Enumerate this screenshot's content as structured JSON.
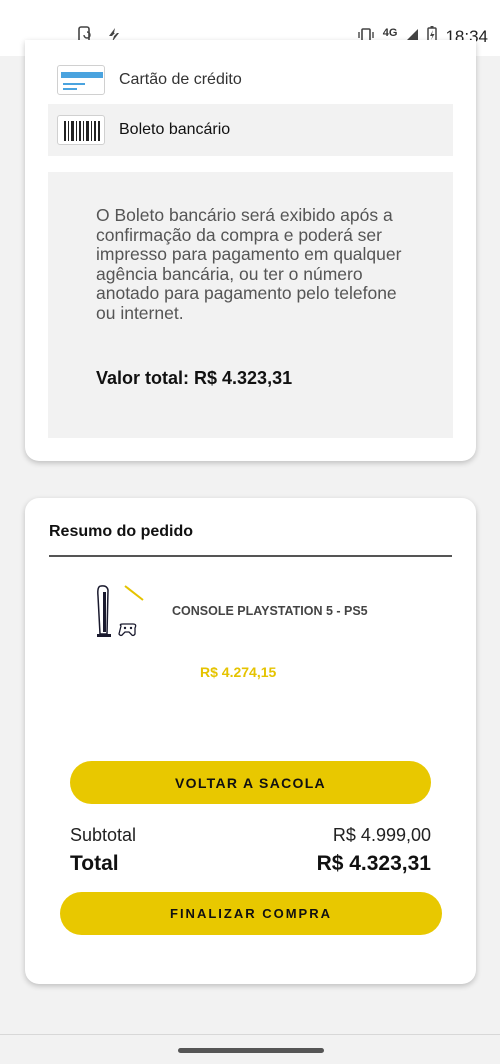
{
  "status_bar": {
    "left_icons": [
      "phone-sync-icon",
      "no-signal-bolt-icon"
    ],
    "right_icons": [
      "vibrate-icon",
      "signal-icon",
      "battery-charging-icon"
    ],
    "network": "4G",
    "time": "18:34"
  },
  "payment": {
    "options": [
      {
        "label": "Cartão de crédito",
        "icon": "credit-card-icon",
        "selected": false
      },
      {
        "label": "Boleto bancário",
        "icon": "barcode-icon",
        "selected": true
      }
    ],
    "boleto_info": "O Boleto bancário será exibido após a confirmação da compra e poderá ser impresso para pagamento em qualquer agência bancária, ou ter o número anotado para pagamento pelo telefone ou internet.",
    "total_label": "Valor total: R$ 4.323,31"
  },
  "summary": {
    "title": "Resumo do pedido",
    "product": {
      "name": "CONSOLE PLAYSTATION 5 - PS5",
      "price": "R$ 4.274,15",
      "image": "playstation-5-console-image"
    },
    "back_button": "VOLTAR A SACOLA",
    "subtotal_label": "Subtotal",
    "subtotal_value": "R$ 4.999,00",
    "total_label": "Total",
    "total_value": "R$ 4.323,31",
    "finish_button": "FINALIZAR COMPRA"
  },
  "colors": {
    "accent": "#e8c800",
    "price": "#e5c300",
    "card_icon_blue": "#4aa3df"
  }
}
